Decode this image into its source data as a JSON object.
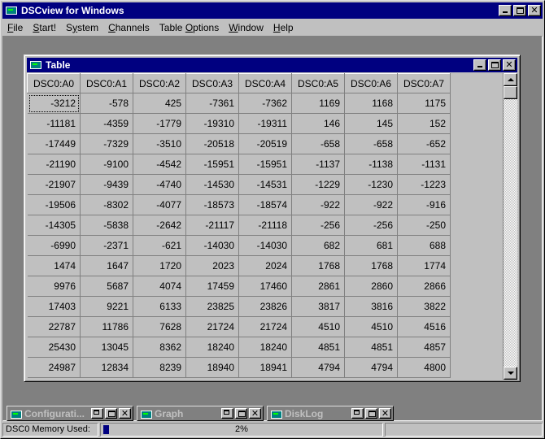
{
  "app": {
    "title": "DSCview for Windows",
    "icon": "dsc-app-icon"
  },
  "menu": [
    {
      "label": "File",
      "key": "F"
    },
    {
      "label": "Start!",
      "key": "S"
    },
    {
      "label": "System",
      "key": "y"
    },
    {
      "label": "Channels",
      "key": "C"
    },
    {
      "label": "Table Options",
      "key": "O"
    },
    {
      "label": "Window",
      "key": "W"
    },
    {
      "label": "Help",
      "key": "H"
    }
  ],
  "table_window": {
    "title": "Table",
    "columns": [
      "DSC0:A0",
      "DSC0:A1",
      "DSC0:A2",
      "DSC0:A3",
      "DSC0:A4",
      "DSC0:A5",
      "DSC0:A6",
      "DSC0:A7"
    ],
    "rows": [
      [
        "-3212",
        "-578",
        "425",
        "-7361",
        "-7362",
        "1169",
        "1168",
        "1175"
      ],
      [
        "-11181",
        "-4359",
        "-1779",
        "-19310",
        "-19311",
        "146",
        "145",
        "152"
      ],
      [
        "-17449",
        "-7329",
        "-3510",
        "-20518",
        "-20519",
        "-658",
        "-658",
        "-652"
      ],
      [
        "-21190",
        "-9100",
        "-4542",
        "-15951",
        "-15951",
        "-1137",
        "-1138",
        "-1131"
      ],
      [
        "-21907",
        "-9439",
        "-4740",
        "-14530",
        "-14531",
        "-1229",
        "-1230",
        "-1223"
      ],
      [
        "-19506",
        "-8302",
        "-4077",
        "-18573",
        "-18574",
        "-922",
        "-922",
        "-916"
      ],
      [
        "-14305",
        "-5838",
        "-2642",
        "-21117",
        "-21118",
        "-256",
        "-256",
        "-250"
      ],
      [
        "-6990",
        "-2371",
        "-621",
        "-14030",
        "-14030",
        "682",
        "681",
        "688"
      ],
      [
        "1474",
        "1647",
        "1720",
        "2023",
        "2024",
        "1768",
        "1768",
        "1774"
      ],
      [
        "9976",
        "5687",
        "4074",
        "17459",
        "17460",
        "2861",
        "2860",
        "2866"
      ],
      [
        "17403",
        "9221",
        "6133",
        "23825",
        "23826",
        "3817",
        "3816",
        "3822"
      ],
      [
        "22787",
        "11786",
        "7628",
        "21724",
        "21724",
        "4510",
        "4510",
        "4516"
      ],
      [
        "25430",
        "13045",
        "8362",
        "18240",
        "18240",
        "4851",
        "4851",
        "4857"
      ],
      [
        "24987",
        "12834",
        "8239",
        "18940",
        "18941",
        "4794",
        "4794",
        "4800"
      ]
    ]
  },
  "minimized_windows": [
    {
      "label": "Configurati...",
      "name": "configuration"
    },
    {
      "label": "Graph",
      "name": "graph"
    },
    {
      "label": "DiskLog",
      "name": "disklog"
    }
  ],
  "status": {
    "label": "DSC0 Memory Used:",
    "progress_percent": 2,
    "progress_text": "2%"
  },
  "colors": {
    "titlebar": "#000080",
    "face": "#c0c0c0",
    "mdi_background": "#808080"
  }
}
